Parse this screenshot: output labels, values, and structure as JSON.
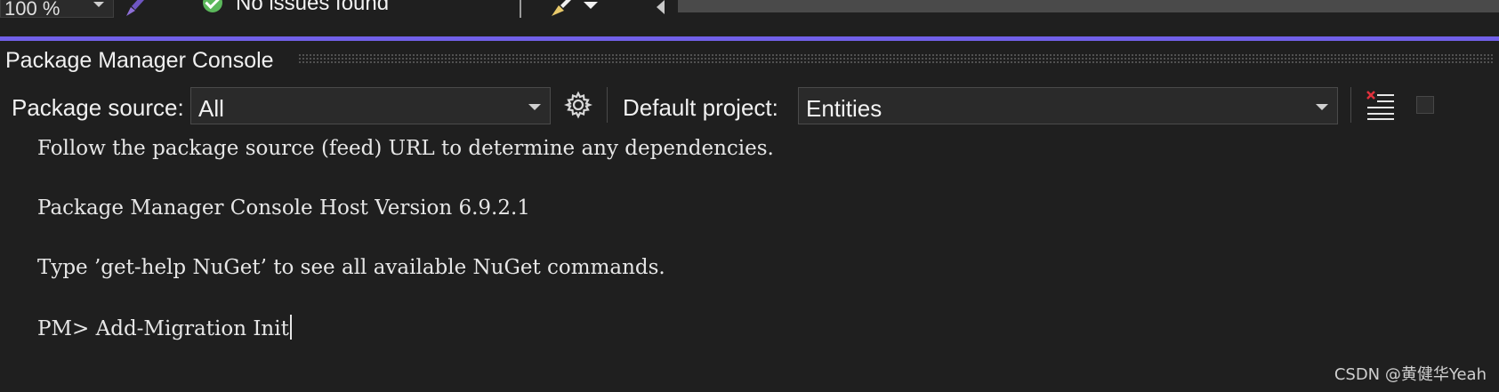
{
  "status_bar": {
    "zoom": "100 %",
    "issues": "No issues found"
  },
  "panel": {
    "title": "Package Manager Console"
  },
  "toolbar": {
    "package_source_label": "Package source:",
    "package_source_value": "All",
    "default_project_label": "Default project:",
    "default_project_value": "Entities",
    "icons": [
      "paint-brush-icon",
      "success-check-icon",
      "cleanup-broom-icon",
      "scroll-left-icon",
      "settings-gear-icon",
      "clear-console-icon",
      "stop-command-icon"
    ]
  },
  "console": {
    "lines": [
      "Follow the package source (feed) URL to determine any dependencies.",
      "Package Manager Console Host Version 6.9.2.1",
      "Type ’get-help NuGet’ to see all available NuGet commands."
    ],
    "prompt": "PM> ",
    "command": "Add-Migration Init"
  },
  "watermark": "CSDN @黄健华Yeah",
  "colors": {
    "accent": "#7160e8",
    "background": "#1f1f1f",
    "check": "#5bb85b",
    "clear_x": "#e0313c"
  }
}
